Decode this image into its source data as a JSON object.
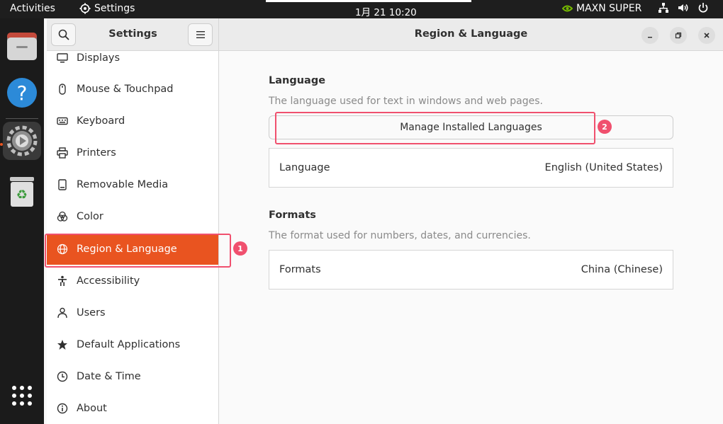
{
  "topbar": {
    "activities": "Activities",
    "app_name": "Settings",
    "clock": "1月 21  10:20",
    "power_mode": "MAXN SUPER",
    "icons": [
      "network-icon",
      "volume-icon",
      "power-icon"
    ]
  },
  "dock": {
    "items": [
      "files-icon",
      "help-icon",
      "settings-icon",
      "trash-icon",
      "show-apps-icon"
    ],
    "active": "settings-icon"
  },
  "sidebar": {
    "title": "Settings",
    "items": [
      {
        "label": "Displays",
        "icon": "display-icon"
      },
      {
        "label": "Mouse & Touchpad",
        "icon": "mouse-icon"
      },
      {
        "label": "Keyboard",
        "icon": "keyboard-icon"
      },
      {
        "label": "Printers",
        "icon": "printer-icon"
      },
      {
        "label": "Removable Media",
        "icon": "removable-media-icon"
      },
      {
        "label": "Color",
        "icon": "color-icon"
      },
      {
        "label": "Region & Language",
        "icon": "globe-icon",
        "selected": true
      },
      {
        "label": "Accessibility",
        "icon": "accessibility-icon"
      },
      {
        "label": "Users",
        "icon": "users-icon"
      },
      {
        "label": "Default Applications",
        "icon": "star-icon"
      },
      {
        "label": "Date & Time",
        "icon": "clock-icon"
      },
      {
        "label": "About",
        "icon": "info-icon"
      }
    ]
  },
  "main": {
    "title": "Region & Language",
    "language_section": {
      "title": "Language",
      "description": "The language used for text in windows and web pages.",
      "manage_button": "Manage Installed Languages",
      "row_label": "Language",
      "row_value": "English (United States)"
    },
    "formats_section": {
      "title": "Formats",
      "description": "The format used for numbers, dates, and currencies.",
      "row_label": "Formats",
      "row_value": "China (Chinese)"
    }
  },
  "annotations": {
    "badge_1": "1",
    "badge_2": "2",
    "highlight_color": "#f0506e"
  },
  "colors": {
    "accent": "#e95420",
    "topbar": "#1e1e1e",
    "dock": "#1b1b1b"
  }
}
